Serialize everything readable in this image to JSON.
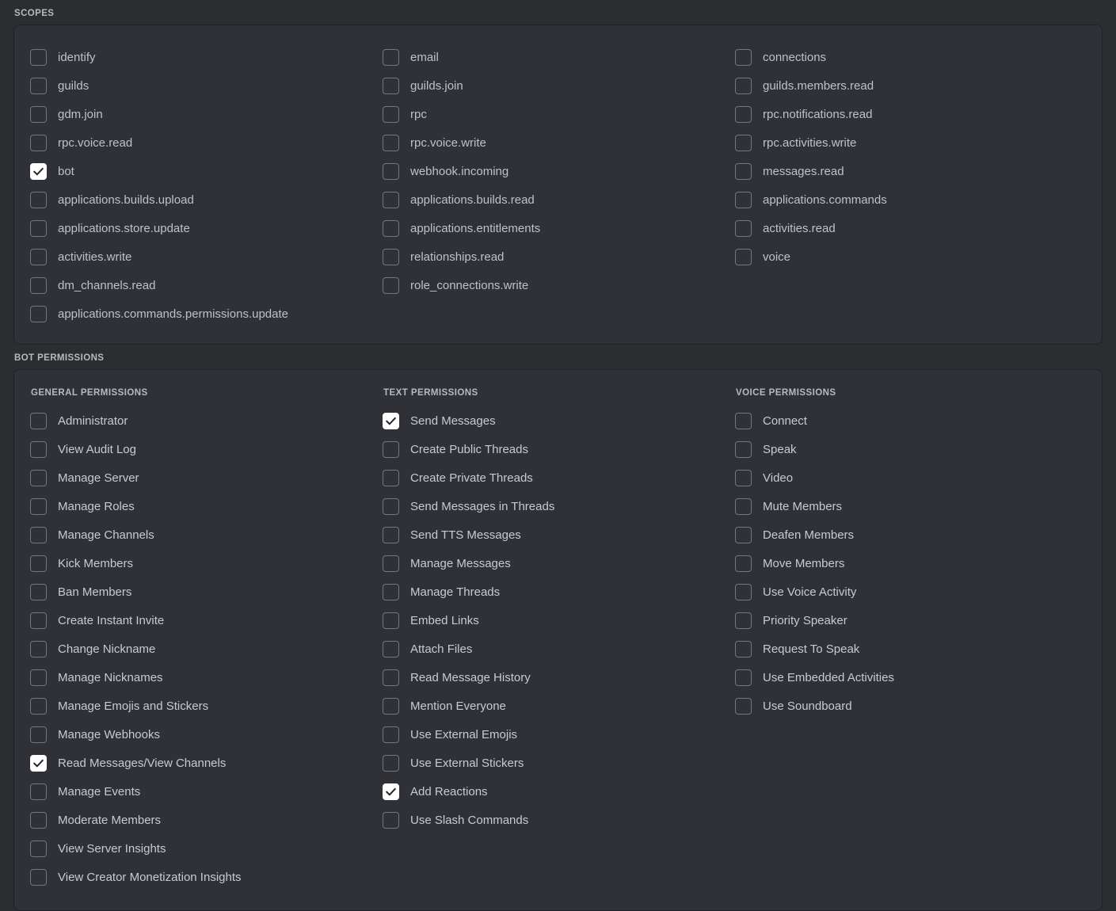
{
  "sections": {
    "scopes_caption": "SCOPES",
    "bot_permissions_caption": "BOT PERMISSIONS"
  },
  "colors": {
    "page_background": "#2b2d31",
    "panel_background": "#2f3136",
    "panel_border": "#202225",
    "checkbox_border": "#72767d",
    "checkbox_checked_background": "#ffffff",
    "checkbox_check_mark": "#1f2225",
    "label_text": "#c5cad0",
    "caption_text": "#b5bac1"
  },
  "scopes": {
    "columns": [
      [
        {
          "label": "identify",
          "checked": false
        },
        {
          "label": "guilds",
          "checked": false
        },
        {
          "label": "gdm.join",
          "checked": false
        },
        {
          "label": "rpc.voice.read",
          "checked": false
        },
        {
          "label": "bot",
          "checked": true
        },
        {
          "label": "applications.builds.upload",
          "checked": false
        },
        {
          "label": "applications.store.update",
          "checked": false
        },
        {
          "label": "activities.write",
          "checked": false
        },
        {
          "label": "dm_channels.read",
          "checked": false
        },
        {
          "label": "applications.commands.permissions.update",
          "checked": false
        }
      ],
      [
        {
          "label": "email",
          "checked": false
        },
        {
          "label": "guilds.join",
          "checked": false
        },
        {
          "label": "rpc",
          "checked": false
        },
        {
          "label": "rpc.voice.write",
          "checked": false
        },
        {
          "label": "webhook.incoming",
          "checked": false
        },
        {
          "label": "applications.builds.read",
          "checked": false
        },
        {
          "label": "applications.entitlements",
          "checked": false
        },
        {
          "label": "relationships.read",
          "checked": false
        },
        {
          "label": "role_connections.write",
          "checked": false
        }
      ],
      [
        {
          "label": "connections",
          "checked": false
        },
        {
          "label": "guilds.members.read",
          "checked": false
        },
        {
          "label": "rpc.notifications.read",
          "checked": false
        },
        {
          "label": "rpc.activities.write",
          "checked": false
        },
        {
          "label": "messages.read",
          "checked": false
        },
        {
          "label": "applications.commands",
          "checked": false
        },
        {
          "label": "activities.read",
          "checked": false
        },
        {
          "label": "voice",
          "checked": false
        }
      ]
    ]
  },
  "bot_permissions": {
    "general": {
      "title": "GENERAL PERMISSIONS",
      "items": [
        {
          "label": "Administrator",
          "checked": false
        },
        {
          "label": "View Audit Log",
          "checked": false
        },
        {
          "label": "Manage Server",
          "checked": false
        },
        {
          "label": "Manage Roles",
          "checked": false
        },
        {
          "label": "Manage Channels",
          "checked": false
        },
        {
          "label": "Kick Members",
          "checked": false
        },
        {
          "label": "Ban Members",
          "checked": false
        },
        {
          "label": "Create Instant Invite",
          "checked": false
        },
        {
          "label": "Change Nickname",
          "checked": false
        },
        {
          "label": "Manage Nicknames",
          "checked": false
        },
        {
          "label": "Manage Emojis and Stickers",
          "checked": false
        },
        {
          "label": "Manage Webhooks",
          "checked": false
        },
        {
          "label": "Read Messages/View Channels",
          "checked": true
        },
        {
          "label": "Manage Events",
          "checked": false
        },
        {
          "label": "Moderate Members",
          "checked": false
        },
        {
          "label": "View Server Insights",
          "checked": false
        },
        {
          "label": "View Creator Monetization Insights",
          "checked": false
        }
      ]
    },
    "text": {
      "title": "TEXT PERMISSIONS",
      "items": [
        {
          "label": "Send Messages",
          "checked": true
        },
        {
          "label": "Create Public Threads",
          "checked": false
        },
        {
          "label": "Create Private Threads",
          "checked": false
        },
        {
          "label": "Send Messages in Threads",
          "checked": false
        },
        {
          "label": "Send TTS Messages",
          "checked": false
        },
        {
          "label": "Manage Messages",
          "checked": false
        },
        {
          "label": "Manage Threads",
          "checked": false
        },
        {
          "label": "Embed Links",
          "checked": false
        },
        {
          "label": "Attach Files",
          "checked": false
        },
        {
          "label": "Read Message History",
          "checked": false
        },
        {
          "label": "Mention Everyone",
          "checked": false
        },
        {
          "label": "Use External Emojis",
          "checked": false
        },
        {
          "label": "Use External Stickers",
          "checked": false
        },
        {
          "label": "Add Reactions",
          "checked": true
        },
        {
          "label": "Use Slash Commands",
          "checked": false
        }
      ]
    },
    "voice": {
      "title": "VOICE PERMISSIONS",
      "items": [
        {
          "label": "Connect",
          "checked": false
        },
        {
          "label": "Speak",
          "checked": false
        },
        {
          "label": "Video",
          "checked": false
        },
        {
          "label": "Mute Members",
          "checked": false
        },
        {
          "label": "Deafen Members",
          "checked": false
        },
        {
          "label": "Move Members",
          "checked": false
        },
        {
          "label": "Use Voice Activity",
          "checked": false
        },
        {
          "label": "Priority Speaker",
          "checked": false
        },
        {
          "label": "Request To Speak",
          "checked": false
        },
        {
          "label": "Use Embedded Activities",
          "checked": false
        },
        {
          "label": "Use Soundboard",
          "checked": false
        }
      ]
    }
  }
}
